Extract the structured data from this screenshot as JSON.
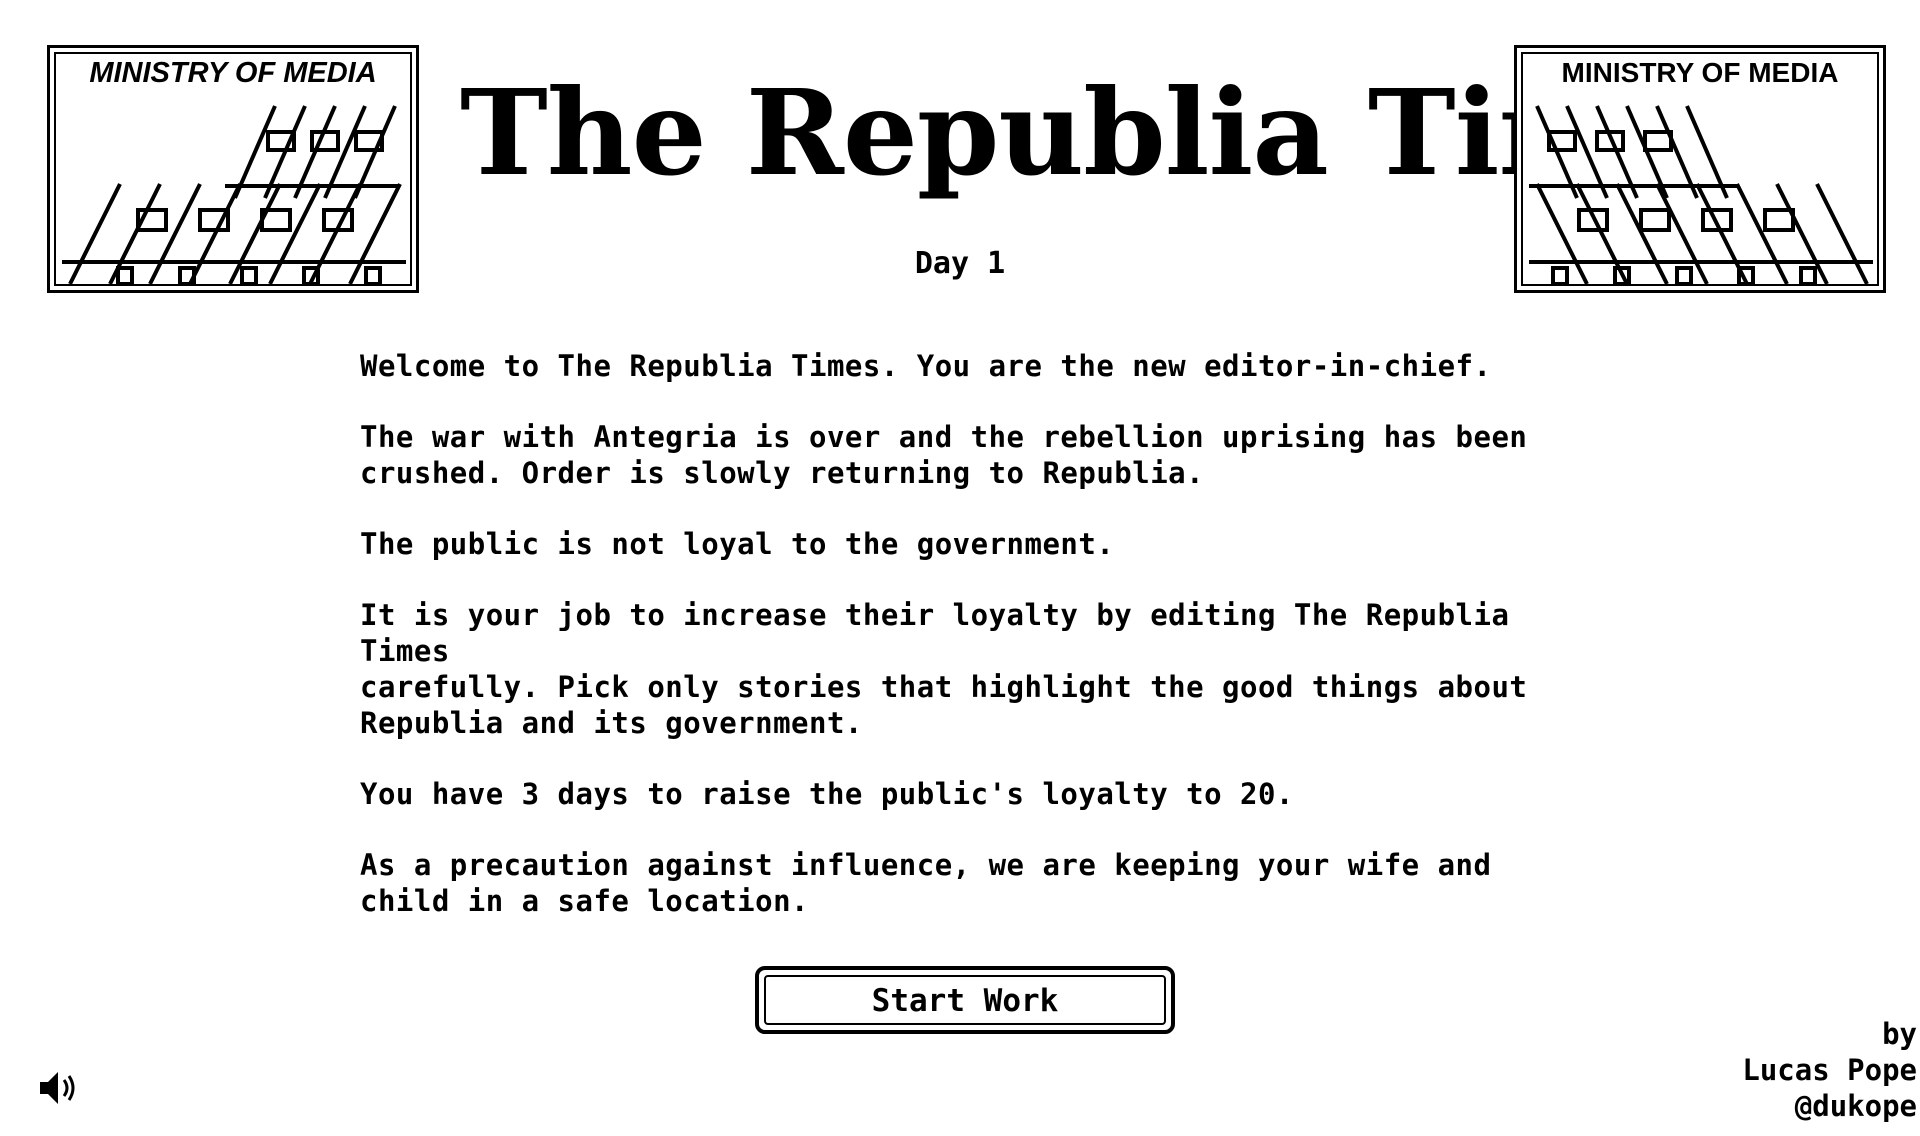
{
  "header": {
    "emblem_text": "MINISTRY OF MEDIA",
    "title": "The Republia Times",
    "day": "Day 1"
  },
  "intro": {
    "paragraphs": [
      "Welcome to The Republia Times. You are the new editor-in-chief.",
      "The war with Antegria is over and the rebellion uprising has been\ncrushed. Order is slowly returning to Republia.",
      "The public is not loyal to the government.",
      "It is your job to increase their loyalty by editing The Republia Times\ncarefully. Pick only stories that highlight the good things about\nRepublia and its government.",
      "You have 3 days to raise the public's loyalty to 20.",
      "As a precaution against influence, we are keeping your wife and\nchild in a safe location."
    ]
  },
  "actions": {
    "start_label": "Start Work"
  },
  "credits": {
    "line1": "by",
    "line2": "Lucas Pope",
    "line3": "@dukope"
  },
  "icons": {
    "sound": "speaker-icon",
    "emblem": "ministry-building-icon"
  },
  "colors": {
    "background": "#ffffff",
    "foreground": "#000000"
  }
}
